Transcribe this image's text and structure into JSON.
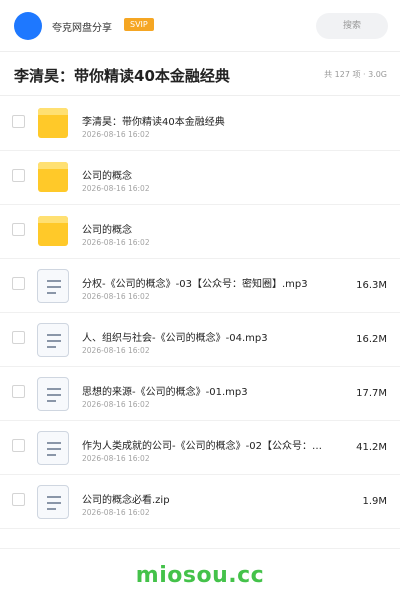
{
  "header": {
    "brand": "夸克网盘分享",
    "badge": "SVIP",
    "search_placeholder": "搜索"
  },
  "share": {
    "title": "李清昊：带你精读40本金融经典",
    "meta": "共 127 项 · 3.0G"
  },
  "files": [
    {
      "type": "folder",
      "name": "李清昊：带你精读40本金融经典",
      "date": "2026-08-16 16:02",
      "size": ""
    },
    {
      "type": "folder",
      "name": "公司的概念",
      "date": "2026-08-16 16:02",
      "size": ""
    },
    {
      "type": "folder",
      "name": "公司的概念",
      "date": "2026-08-16 16:02",
      "size": ""
    },
    {
      "type": "file",
      "name": "分权-《公司的概念》-03【公众号：密知圈】.mp3",
      "date": "2026-08-16 16:02",
      "size": "16.3M"
    },
    {
      "type": "file",
      "name": "人、组织与社会-《公司的概念》-04.mp3",
      "date": "2026-08-16 16:02",
      "size": "16.2M"
    },
    {
      "type": "file",
      "name": "思想的来源-《公司的概念》-01.mp3",
      "date": "2026-08-16 16:02",
      "size": "17.7M"
    },
    {
      "type": "file",
      "name": "作为人类成就的公司-《公司的概念》-02【公众号：…",
      "date": "2026-08-16 16:02",
      "size": "41.2M"
    },
    {
      "type": "file",
      "name": "公司的概念必看.zip",
      "date": "2026-08-16 16:02",
      "size": "1.9M"
    }
  ],
  "watermark": "miosou.cc",
  "colors": {
    "accent": "#1e78ff",
    "badge": "#f5a623",
    "folder": "#ffc929",
    "watermark": "#44c24a"
  }
}
